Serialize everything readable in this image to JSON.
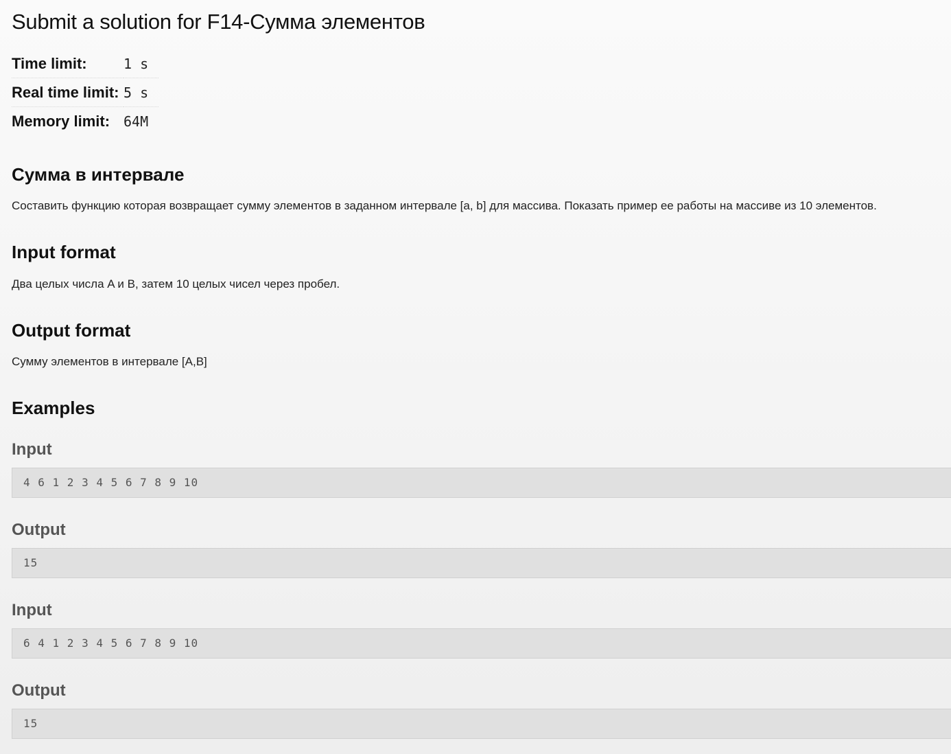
{
  "title": "Submit a solution for F14-Сумма элементов",
  "limits": [
    {
      "label": "Time limit:",
      "value": "1 s"
    },
    {
      "label": "Real time limit:",
      "value": "5 s"
    },
    {
      "label": "Memory limit:",
      "value": "64M"
    }
  ],
  "statement": {
    "heading": "Сумма в интервале",
    "text": "Составить функцию которая возвращает сумму элементов в заданном интервале [a, b] для массива. Показать пример ее работы на массиве из 10 элементов."
  },
  "input_format": {
    "heading": "Input format",
    "text": "Два целых числа A и B, затем 10 целых чисел через пробел."
  },
  "output_format": {
    "heading": "Output format",
    "text": "Сумму элементов в интервале [A,B]"
  },
  "examples": {
    "heading": "Examples",
    "items": [
      {
        "input_label": "Input",
        "input": "4 6 1 2 3 4 5 6 7 8 9 10",
        "output_label": "Output",
        "output": "15"
      },
      {
        "input_label": "Input",
        "input": "6 4 1 2 3 4 5 6 7 8 9 10",
        "output_label": "Output",
        "output": "15"
      }
    ]
  }
}
